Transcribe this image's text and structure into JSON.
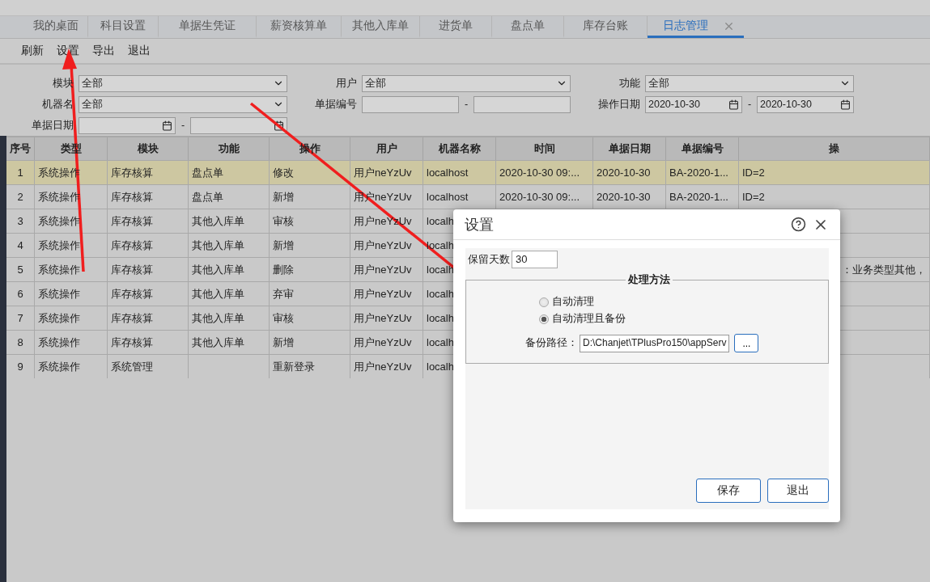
{
  "tabs": [
    {
      "label": "我的桌面",
      "selected": false
    },
    {
      "label": "科目设置",
      "selected": false
    },
    {
      "label": "单据生凭证",
      "selected": false
    },
    {
      "label": "薪资核算单",
      "selected": false
    },
    {
      "label": "其他入库单",
      "selected": false
    },
    {
      "label": "进货单",
      "selected": false
    },
    {
      "label": "盘点单",
      "selected": false
    },
    {
      "label": "库存台账",
      "selected": false
    },
    {
      "label": "日志管理",
      "selected": true,
      "closable": true
    }
  ],
  "toolbar": [
    "刷新",
    "设置",
    "导出",
    "退出"
  ],
  "filters": [
    [
      {
        "kind": "select",
        "label": "模块",
        "value": "全部"
      },
      {
        "kind": "select",
        "label": "用户",
        "value": "全部"
      },
      {
        "kind": "select",
        "label": "功能",
        "value": "全部"
      }
    ],
    [
      {
        "kind": "select",
        "label": "机器名",
        "value": "全部"
      },
      {
        "kind": "text_range",
        "label": "单据编号",
        "separator": "-"
      },
      {
        "kind": "date_range",
        "label": "操作日期",
        "from": "2020-10-30",
        "to": "2020-10-30",
        "separator": "-"
      }
    ],
    [
      {
        "kind": "date_range",
        "label": "单据日期",
        "separator": "-"
      }
    ]
  ],
  "table": {
    "columns": [
      "序号",
      "类型",
      "模块",
      "功能",
      "操作",
      "用户",
      "机器名称",
      "时间",
      "单据日期",
      "单据编号",
      "操"
    ],
    "rows": [
      {
        "selected": true,
        "cells": [
          "1",
          "系统操作",
          "库存核算",
          "盘点单",
          "修改",
          "用户neYzUv",
          "localhost",
          "2020-10-30 09:...",
          "2020-10-30",
          "BA-2020-1...",
          "ID=2"
        ]
      },
      {
        "selected": false,
        "cells": [
          "2",
          "系统操作",
          "库存核算",
          "盘点单",
          "新增",
          "用户neYzUv",
          "localhost",
          "2020-10-30 09:...",
          "2020-10-30",
          "BA-2020-1...",
          "ID=2"
        ]
      },
      {
        "selected": false,
        "cells": [
          "3",
          "系统操作",
          "库存核算",
          "其他入库单",
          "审核",
          "用户neYzUv",
          "localh"
        ]
      },
      {
        "selected": false,
        "cells": [
          "4",
          "系统操作",
          "库存核算",
          "其他入库单",
          "新增",
          "用户neYzUv",
          "localh"
        ]
      },
      {
        "selected": false,
        "cells": [
          "5",
          "系统操作",
          "库存核算",
          "其他入库单",
          "删除",
          "用户neYzUv",
          "localh"
        ],
        "tail": "：业务类型其他，"
      },
      {
        "selected": false,
        "cells": [
          "6",
          "系统操作",
          "库存核算",
          "其他入库单",
          "弃审",
          "用户neYzUv",
          "localh"
        ]
      },
      {
        "selected": false,
        "cells": [
          "7",
          "系统操作",
          "库存核算",
          "其他入库单",
          "审核",
          "用户neYzUv",
          "localh"
        ]
      },
      {
        "selected": false,
        "cells": [
          "8",
          "系统操作",
          "库存核算",
          "其他入库单",
          "新增",
          "用户neYzUv",
          "localh"
        ]
      },
      {
        "selected": false,
        "cells": [
          "9",
          "系统操作",
          "系统管理",
          "",
          "重新登录",
          "用户neYzUv",
          "localh"
        ]
      }
    ]
  },
  "dialog": {
    "title": "设置",
    "retain_label": "保留天数",
    "retain_value": "30",
    "group_title": "处理方法",
    "options": [
      {
        "label": "自动清理",
        "selected": false
      },
      {
        "label": "自动清理且备份",
        "selected": true
      }
    ],
    "path_label": "备份路径：",
    "path_value": "D:\\Chanjet\\TPlusPro150\\appServ",
    "browse": "...",
    "buttons": [
      "保存",
      "退出"
    ]
  }
}
